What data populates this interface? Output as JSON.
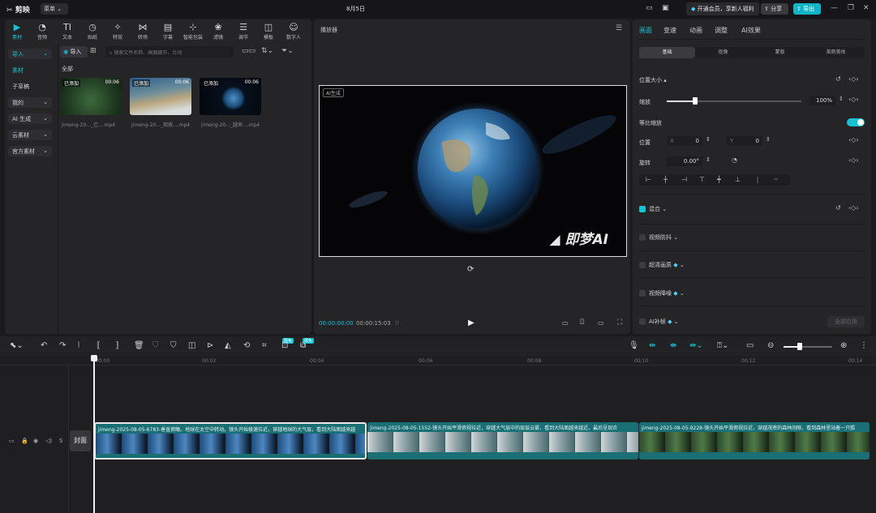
{
  "app": {
    "title": "剪映",
    "menu": "菜单",
    "date": "8月5日",
    "vip": "开通会员，享新人福利",
    "share": "分享",
    "export": "导出"
  },
  "toolbar": [
    {
      "label": "素材",
      "icon": "media-icon"
    },
    {
      "label": "音频",
      "icon": "audio-icon"
    },
    {
      "label": "文本",
      "icon": "text-icon"
    },
    {
      "label": "贴纸",
      "icon": "sticker-icon"
    },
    {
      "label": "特效",
      "icon": "effects-icon"
    },
    {
      "label": "转场",
      "icon": "transition-icon"
    },
    {
      "label": "字幕",
      "icon": "subtitle-icon"
    },
    {
      "label": "智能包装",
      "icon": "smart-pack-icon"
    },
    {
      "label": "滤镜",
      "icon": "filter-icon"
    },
    {
      "label": "调节",
      "icon": "adjust-icon"
    },
    {
      "label": "模板",
      "icon": "template-icon"
    },
    {
      "label": "数字人",
      "icon": "digital-human-icon"
    }
  ],
  "sidebar": [
    {
      "label": "导入"
    },
    {
      "label": "素材"
    },
    {
      "label": "子草稿"
    },
    {
      "label": "我的"
    },
    {
      "label": "AI 生成"
    },
    {
      "label": "云素材"
    },
    {
      "label": "官方素材"
    }
  ],
  "media": {
    "import_label": "导入",
    "search_placeholder": "搜索文件名称、画面细节、台词",
    "section": "全部",
    "items": [
      {
        "tag": "已添加",
        "duration": "00:06",
        "name": "jimeng-20..._它....mp4"
      },
      {
        "tag": "已添加",
        "duration": "00:06",
        "name": "jimeng-20..._观夜....mp4"
      },
      {
        "tag": "已添加",
        "duration": "00:06",
        "name": "jimeng-20..._越来....mp4"
      }
    ]
  },
  "player": {
    "title": "播放器",
    "ai_tag": "AI生成",
    "watermark": "即梦AI",
    "current_time": "00:00:00:00",
    "total_time": "00:00:15:03"
  },
  "inspector": {
    "tabs": [
      "画面",
      "变速",
      "动画",
      "调整",
      "AI效果"
    ],
    "subtabs": [
      "基础",
      "抠像",
      "蒙版",
      "美颜美体"
    ],
    "section_position": "位置大小",
    "scale_label": "缩放",
    "scale_value": "100%",
    "uniform_label": "等比缩放",
    "position_label": "位置",
    "x_label": "X",
    "x_value": "0",
    "y_label": "Y",
    "y_value": "0",
    "rotate_label": "旋转",
    "rotate_value": "0.00°",
    "blend_label": "混合",
    "stabilize_label": "视频防抖",
    "hd_label": "超清画质",
    "denoise_label": "视频降噪",
    "ai_fill_label": "AI补帧",
    "apply_all": "全部应用"
  },
  "timeline": {
    "ruler": [
      "00:00",
      "00:02",
      "00:04",
      "00:06",
      "00:08",
      "00:10",
      "00:12",
      "00:14"
    ],
    "cover": "封面",
    "badges": [
      "限免",
      "限免"
    ],
    "clips": [
      {
        "label": "jimeng-2025-08-05-6783-垂直俯瞰。地球在太空中转动。镜头开始极速拉近，穿越地球的大气层，看到大陆面越来越"
      },
      {
        "label": "jimeng-2025-08-05-1552-镜头开始平滑俯视拉近，穿越大气层中的层层云雾，看到大陆面越来越近，最后呈现农"
      },
      {
        "label": "jimeng-2025-08-05-9228-镜头开始平滑俯视拉近，穿越茂密的森林间隙，看到森林里站着一只狐"
      }
    ]
  },
  "colors": {
    "accent": "#14c3d6"
  }
}
